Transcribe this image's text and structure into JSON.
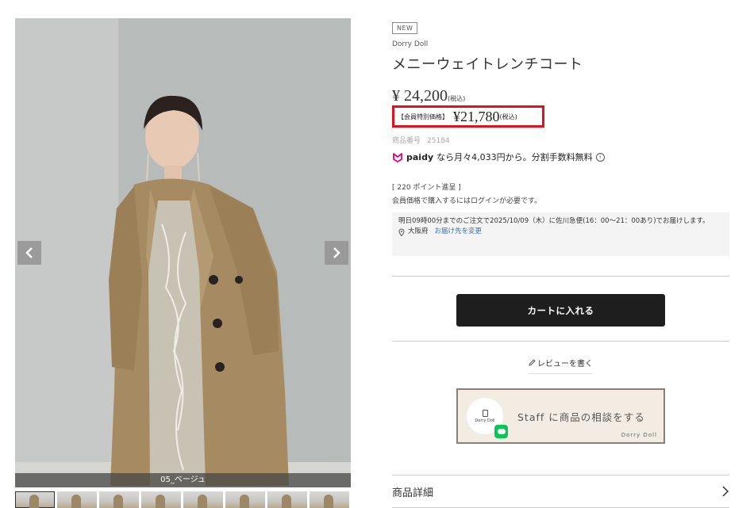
{
  "gallery": {
    "caption": "05_ベージュ",
    "thumbnail_count": 8,
    "active_thumbnail": 1
  },
  "product": {
    "badge": "NEW",
    "brand": "Dorry Doll",
    "title": "メニーウェイトレンチコート",
    "price": "¥ 24,200",
    "price_tax": "(税込)",
    "member_label": "【会員特別価格】",
    "member_price": "¥21,780",
    "member_tax": "(税込)",
    "sku_label": "商品番号",
    "sku_value": "25184"
  },
  "paidy": {
    "logo": "paidy",
    "text": "なら月々4,033円から。分割手数料無料",
    "info_icon": "info-icon"
  },
  "points": {
    "text": "[ 220 ポイント進呈 ]",
    "login_note": "会員価格で購入するにはログインが必要です。"
  },
  "delivery": {
    "message": "明日09時00分までのご注文で2025/10/09（木）に佐川急便(16：00〜21：00あり)でお届けします。",
    "location": "大阪府",
    "change_link": "お届け先を変更"
  },
  "actions": {
    "cart_button": "カートに入れる",
    "review_link": "レビューを書く"
  },
  "staff_banner": {
    "logo_text": "Dorry Doll",
    "text": "Staff に商品の相談をする",
    "brand": "Dorry Doll"
  },
  "details": {
    "label": "商品詳細"
  },
  "colors": {
    "member_border": "#e0121e",
    "cart_bg": "#1e1e1e",
    "paidy_pink": "#e5007e",
    "line_green": "#06c755",
    "link_blue": "#3a6fb0"
  }
}
